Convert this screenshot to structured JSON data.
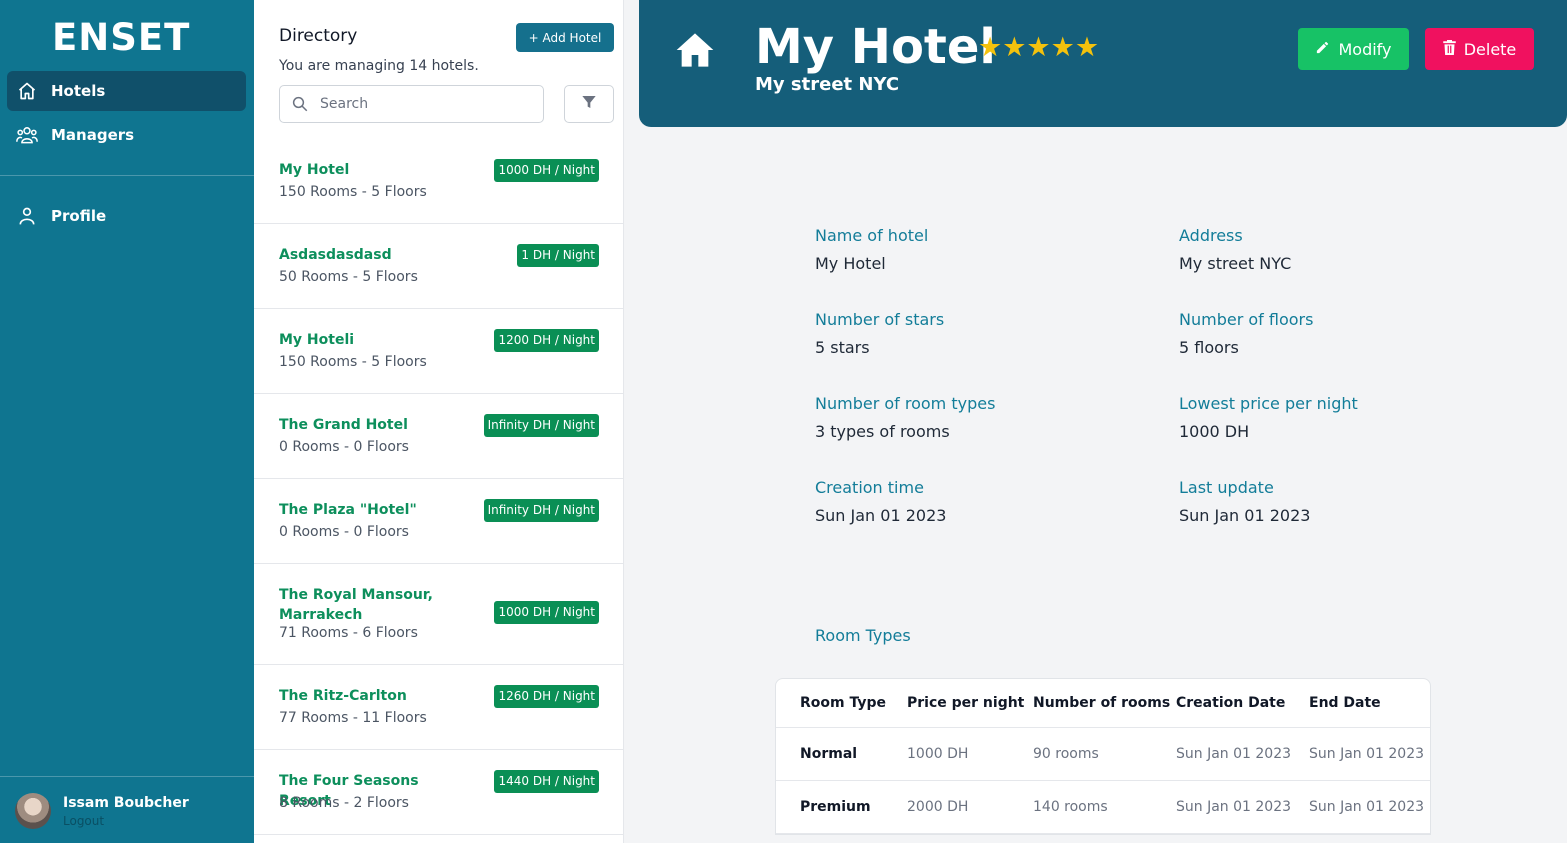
{
  "sidebar": {
    "logo": "ENSET",
    "items": [
      {
        "label": "Hotels",
        "icon": "home-icon",
        "active": true
      },
      {
        "label": "Managers",
        "icon": "users-icon",
        "active": false
      },
      {
        "label": "Profile",
        "icon": "user-icon",
        "active": false
      }
    ],
    "user": {
      "name": "Issam Boubcher",
      "logout": "Logout"
    }
  },
  "directory": {
    "title": "Directory",
    "subtitle": "You are managing 14 hotels.",
    "add_label": "+ Add Hotel",
    "search_placeholder": "Search",
    "hotels": [
      {
        "name": "My Hotel",
        "meta": "150 Rooms - 5 Floors",
        "price": "1000 DH / Night"
      },
      {
        "name": "Asdasdasdasd",
        "meta": "50 Rooms - 5 Floors",
        "price": "1 DH / Night"
      },
      {
        "name": "My Hoteli",
        "meta": "150 Rooms - 5 Floors",
        "price": "1200 DH / Night"
      },
      {
        "name": "The Grand Hotel",
        "meta": "0 Rooms - 0 Floors",
        "price": "Infinity DH / Night"
      },
      {
        "name": "The Plaza \"Hotel\"",
        "meta": "0 Rooms - 0 Floors",
        "price": "Infinity DH / Night"
      },
      {
        "name": "The Royal Mansour, Marrakech",
        "meta": "71 Rooms - 6 Floors",
        "price": "1000 DH / Night"
      },
      {
        "name": "The Ritz-Carlton",
        "meta": "77 Rooms - 11 Floors",
        "price": "1260 DH / Night"
      },
      {
        "name": "The Four Seasons Resort",
        "meta": "8 Rooms - 2 Floors",
        "price": "1440 DH / Night"
      }
    ]
  },
  "header": {
    "title": "My Hotel",
    "stars": "★★★★★",
    "address": "My street NYC",
    "modify_label": "Modify",
    "delete_label": "Delete"
  },
  "details": [
    {
      "label": "Name of hotel",
      "value": "My Hotel"
    },
    {
      "label": "Address",
      "value": "My street NYC"
    },
    {
      "label": "Number of stars",
      "value": "5 stars"
    },
    {
      "label": "Number of floors",
      "value": "5 floors"
    },
    {
      "label": "Number of room types",
      "value": "3 types of rooms"
    },
    {
      "label": "Lowest price per night",
      "value": "1000 DH"
    },
    {
      "label": "Creation time",
      "value": "Sun Jan 01 2023"
    },
    {
      "label": "Last update",
      "value": "Sun Jan 01 2023"
    }
  ],
  "room_types": {
    "title": "Room Types",
    "columns": [
      "Room Type",
      "Price per night",
      "Number of rooms",
      "Creation Date",
      "End Date"
    ],
    "rows": [
      [
        "Normal",
        "1000 DH",
        "90 rooms",
        "Sun Jan 01 2023",
        "Sun Jan 01 2023"
      ],
      [
        "Premium",
        "2000 DH",
        "140 rooms",
        "Sun Jan 01 2023",
        "Sun Jan 01 2023"
      ]
    ]
  },
  "colors": {
    "sidebar": "#0f7590",
    "header": "#155e7a",
    "accent_green": "#0a8f55",
    "modify": "#17c266",
    "delete": "#f0115f",
    "label": "#137d99"
  }
}
